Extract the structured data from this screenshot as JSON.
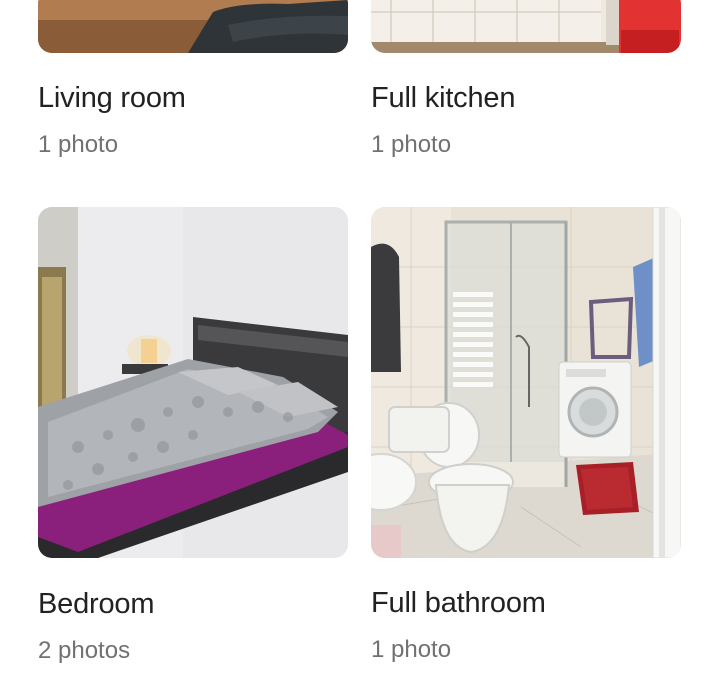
{
  "rooms": [
    {
      "title": "Living room",
      "count": "1 photo"
    },
    {
      "title": "Full kitchen",
      "count": "1 photo"
    },
    {
      "title": "Bedroom",
      "count": "2 photos"
    },
    {
      "title": "Full bathroom",
      "count": "1 photo"
    }
  ]
}
